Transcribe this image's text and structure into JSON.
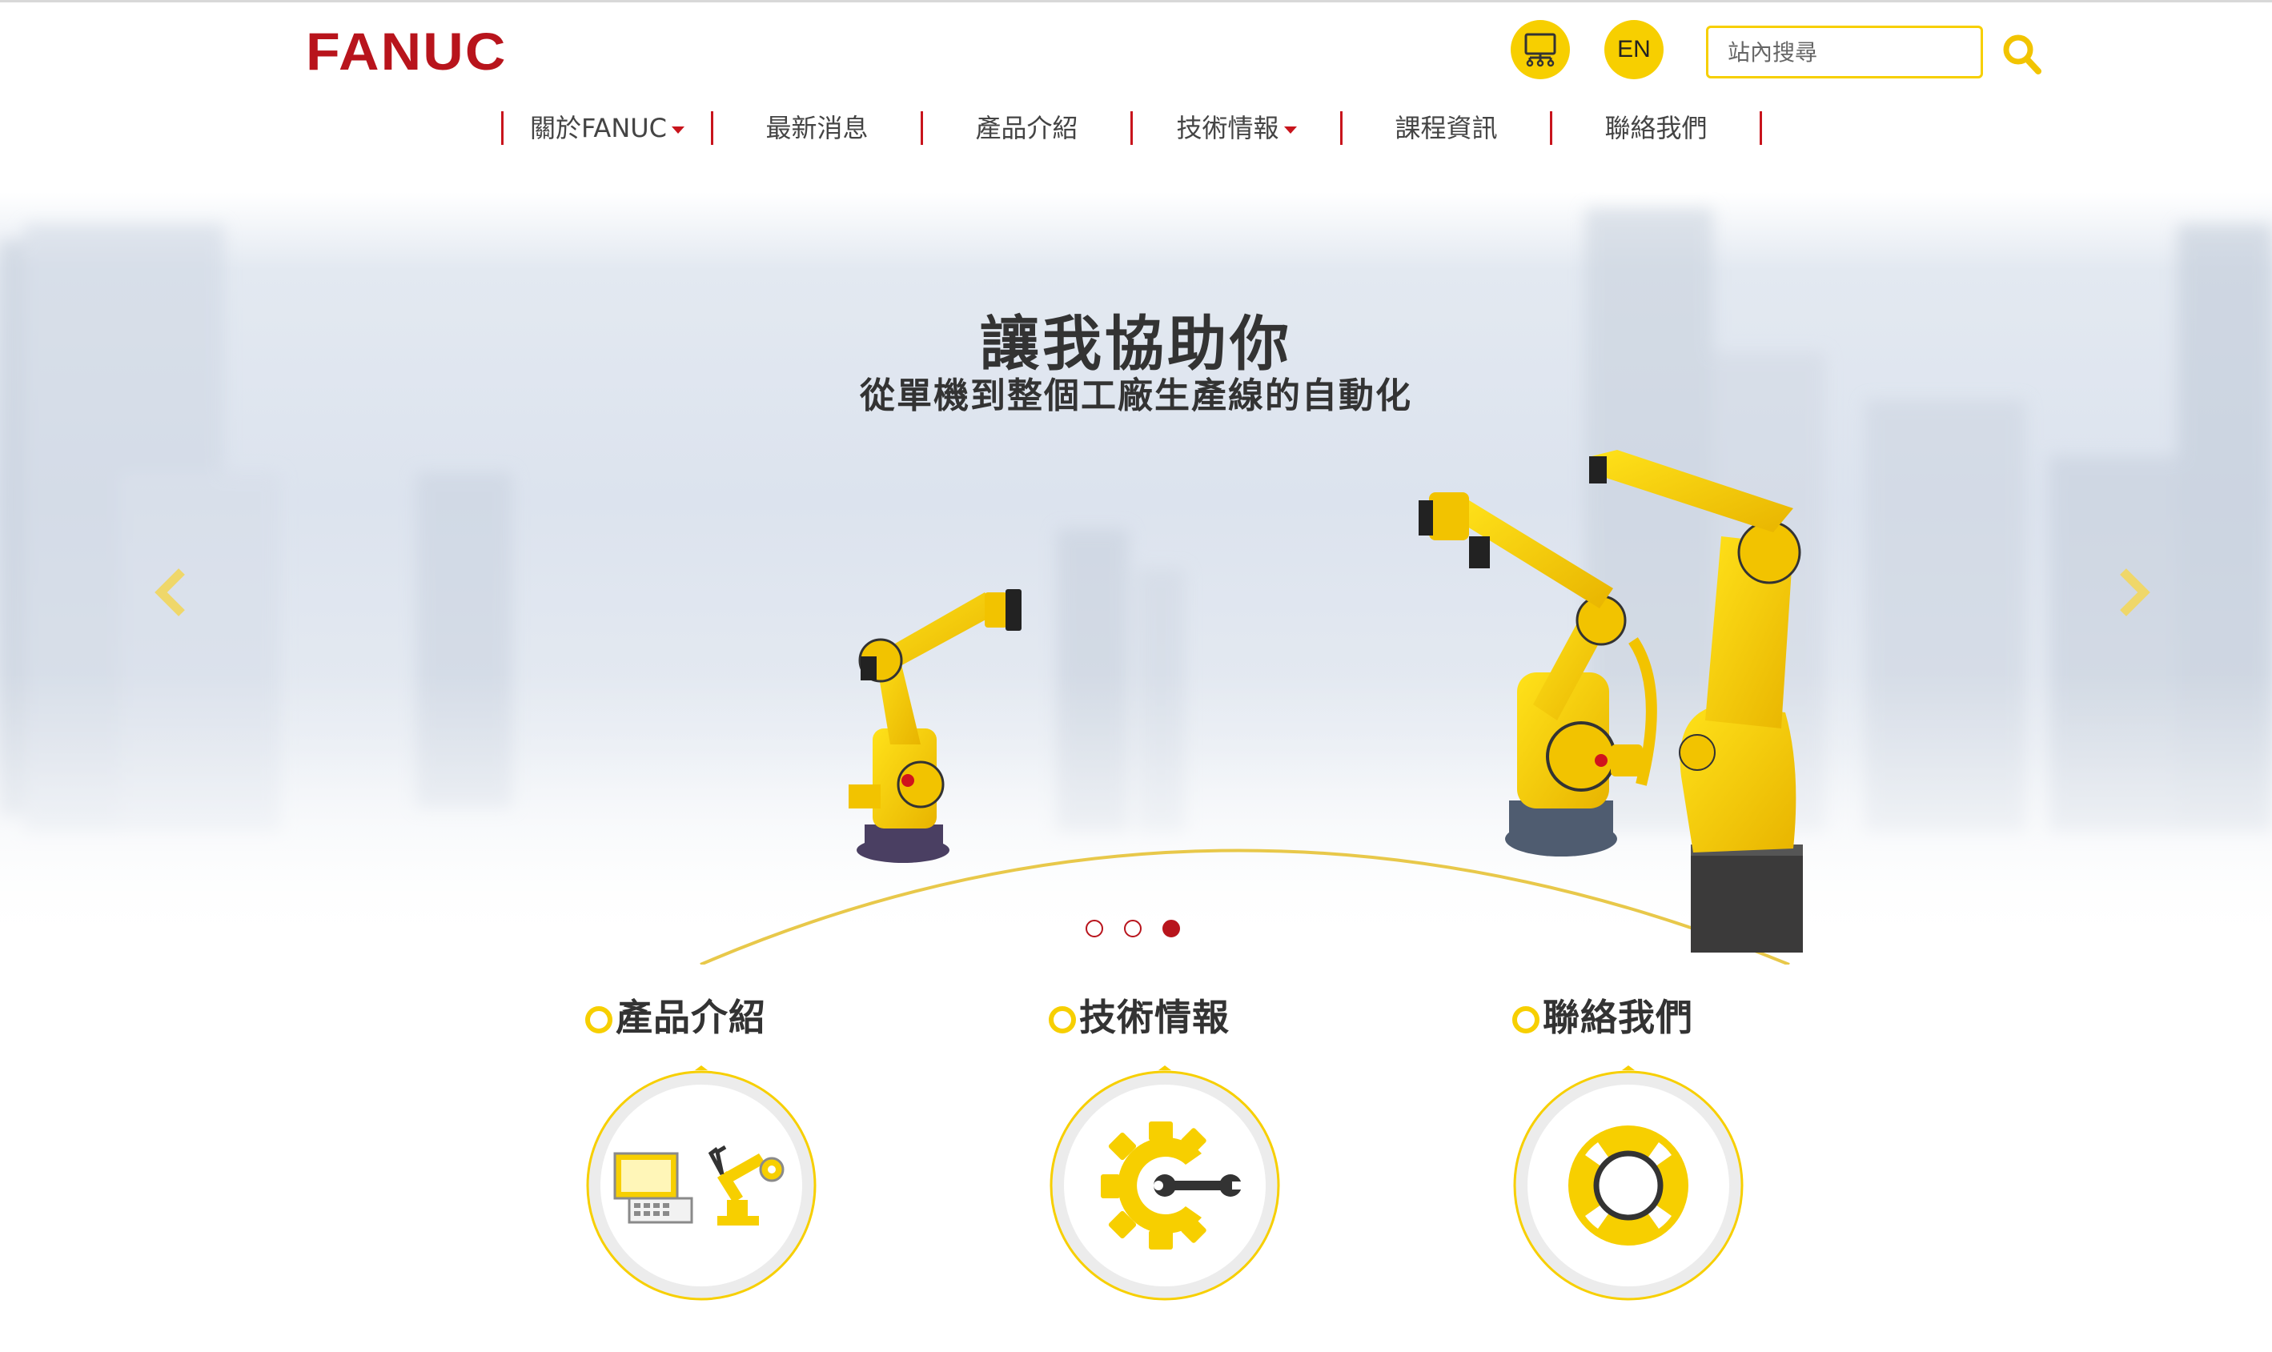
{
  "header": {
    "logo_text": "FANUC",
    "lang_label": "EN",
    "search_placeholder": "站內搜尋",
    "accent_color": "#f7cf00",
    "brand_color": "#b8141c"
  },
  "nav": {
    "items": [
      {
        "label": "關於FANUC",
        "has_dropdown": true
      },
      {
        "label": "最新消息",
        "has_dropdown": false
      },
      {
        "label": "產品介紹",
        "has_dropdown": false
      },
      {
        "label": "技術情報",
        "has_dropdown": true
      },
      {
        "label": "課程資訊",
        "has_dropdown": false
      },
      {
        "label": "聯絡我們",
        "has_dropdown": false
      }
    ]
  },
  "hero": {
    "title": "讓我協助你",
    "subtitle": "從單機到整個工廠生產線的自動化",
    "slide_count": 3,
    "active_slide": 3
  },
  "features": [
    {
      "label": "產品介紹",
      "icon": "product-robot-icon"
    },
    {
      "label": "技術情報",
      "icon": "gear-wrench-icon"
    },
    {
      "label": "聯絡我們",
      "icon": "lifebuoy-icon"
    }
  ]
}
